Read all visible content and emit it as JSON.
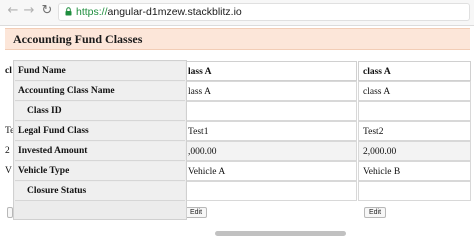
{
  "browser": {
    "url_protocol": "https://",
    "url_host": "angular-d1mzew.stackblitz.io"
  },
  "page": {
    "title": "Accounting Fund Classes"
  },
  "sticky_headers": [
    "Fund Name",
    "Accounting Class Name",
    "Class ID",
    "Legal Fund Class",
    "Invested Amount",
    "Vehicle Type",
    "Closure Status"
  ],
  "table": {
    "left_edge_fragments": [
      "cl",
      "",
      "",
      "Te",
      "2",
      "V",
      ""
    ],
    "column_a": [
      "lass A",
      "lass A",
      "",
      "Test1",
      ",000.00",
      "Vehicle A",
      ""
    ],
    "column_b": [
      "class A",
      "class A",
      "",
      "Test2",
      "2,000.00",
      "Vehicle B",
      ""
    ],
    "edit_label": "Edit"
  }
}
